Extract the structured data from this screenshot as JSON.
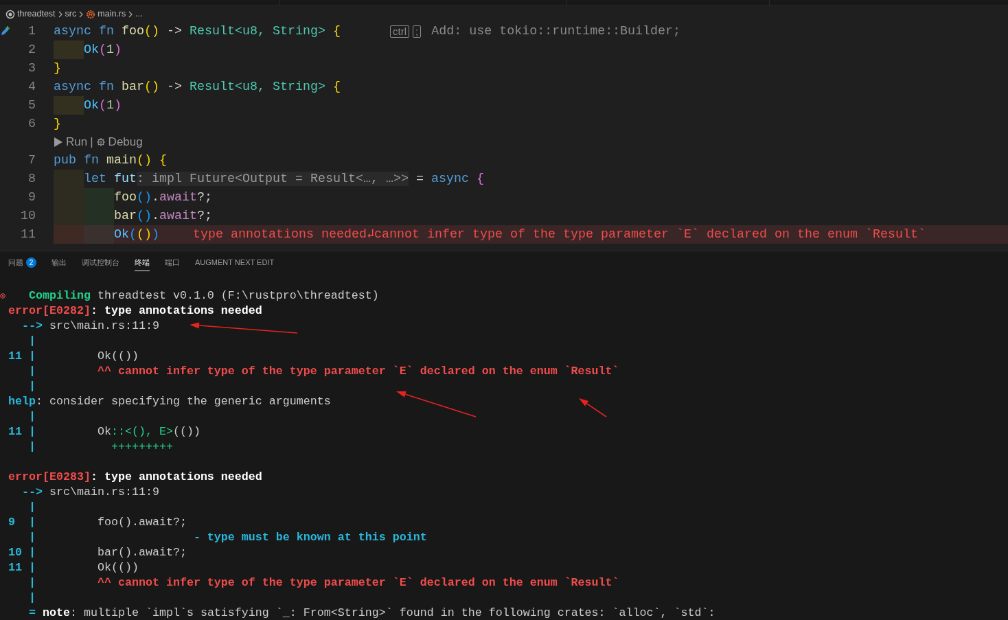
{
  "breadcrumbs": [
    {
      "kind": "root",
      "label": "threadtest"
    },
    {
      "kind": "folder",
      "label": "src"
    },
    {
      "kind": "rust",
      "label": "main.rs"
    },
    {
      "kind": "more",
      "label": "..."
    }
  ],
  "editor": {
    "lines": [
      {
        "kind": "code",
        "number": "1",
        "gutter_mark": {
          "kind": "edit"
        },
        "error": false,
        "tokens": [
          {
            "text": "async ",
            "kind": "kw"
          },
          {
            "text": "fn ",
            "kind": "kw"
          },
          {
            "text": "foo",
            "kind": "fn"
          },
          {
            "text": "()",
            "kind": "b1"
          },
          {
            "text": " -> ",
            "kind": "p"
          },
          {
            "text": "Result<u8, String> ",
            "kind": "ty"
          },
          {
            "text": "{",
            "kind": "b1"
          }
        ],
        "keys": [
          "ctrl",
          ";"
        ],
        "suggestion": "Add: use tokio::runtime::Builder;"
      },
      {
        "kind": "code",
        "number": "2",
        "error": false,
        "guides": [
          {
            "color": "#33301f"
          }
        ],
        "tokens": [
          {
            "text": "Ok",
            "kind": "var"
          },
          {
            "text": "(",
            "kind": "b2"
          },
          {
            "text": "1",
            "kind": "num"
          },
          {
            "text": ")",
            "kind": "b2"
          }
        ]
      },
      {
        "kind": "code",
        "number": "3",
        "error": false,
        "tokens": [
          {
            "text": "}",
            "kind": "b1"
          }
        ]
      },
      {
        "kind": "code",
        "number": "4",
        "error": false,
        "tokens": [
          {
            "text": "async ",
            "kind": "kw"
          },
          {
            "text": "fn ",
            "kind": "kw"
          },
          {
            "text": "bar",
            "kind": "fn"
          },
          {
            "text": "()",
            "kind": "b1"
          },
          {
            "text": " -> ",
            "kind": "p"
          },
          {
            "text": "Result<u8, String> ",
            "kind": "ty"
          },
          {
            "text": "{",
            "kind": "b1"
          }
        ]
      },
      {
        "kind": "code",
        "number": "5",
        "error": false,
        "guides": [
          {
            "color": "#33301f"
          }
        ],
        "tokens": [
          {
            "text": "Ok",
            "kind": "var"
          },
          {
            "text": "(",
            "kind": "b2"
          },
          {
            "text": "1",
            "kind": "num"
          },
          {
            "text": ")",
            "kind": "b2"
          }
        ]
      },
      {
        "kind": "code",
        "number": "6",
        "error": false,
        "tokens": [
          {
            "text": "}",
            "kind": "b1"
          }
        ]
      },
      {
        "kind": "codelens",
        "run": "Run",
        "separator": "|",
        "debug": "Debug"
      },
      {
        "kind": "code",
        "number": "7",
        "error": false,
        "tokens": [
          {
            "text": "pub ",
            "kind": "kw"
          },
          {
            "text": "fn ",
            "kind": "kw"
          },
          {
            "text": "main",
            "kind": "fn"
          },
          {
            "text": "() ",
            "kind": "b1"
          },
          {
            "text": "{",
            "kind": "b1"
          }
        ]
      },
      {
        "kind": "code",
        "number": "8",
        "error": false,
        "guides": [
          {
            "color": "#2e2c20"
          }
        ],
        "tokens": [
          {
            "text": "let ",
            "kind": "kw"
          },
          {
            "text": "fut",
            "kind": "id"
          },
          {
            "text": ": impl Future<Output = Result<…, …>>",
            "kind": "hint"
          },
          {
            "text": " = ",
            "kind": "p"
          },
          {
            "text": "async ",
            "kind": "kw"
          },
          {
            "text": "{",
            "kind": "b2"
          }
        ]
      },
      {
        "kind": "code",
        "number": "9",
        "error": false,
        "guides": [
          {
            "color": "#2e2c20"
          },
          {
            "color": "#243024"
          }
        ],
        "tokens": [
          {
            "text": "foo",
            "kind": "fn"
          },
          {
            "text": "()",
            "kind": "b3"
          },
          {
            "text": ".",
            "kind": "p"
          },
          {
            "text": "await",
            "kind": "ctl"
          },
          {
            "text": "?;",
            "kind": "p"
          }
        ]
      },
      {
        "kind": "code",
        "number": "10",
        "error": false,
        "guides": [
          {
            "color": "#2e2c20"
          },
          {
            "color": "#243024"
          }
        ],
        "tokens": [
          {
            "text": "bar",
            "kind": "fn"
          },
          {
            "text": "()",
            "kind": "b3"
          },
          {
            "text": ".",
            "kind": "p"
          },
          {
            "text": "await",
            "kind": "ctl"
          },
          {
            "text": "?;",
            "kind": "p"
          }
        ]
      },
      {
        "kind": "code",
        "number": "11",
        "error": true,
        "guides": [
          {
            "color": "#3e2a22"
          },
          {
            "color": "#3a302e"
          }
        ],
        "tokens": [
          {
            "text": "Ok",
            "kind": "var"
          },
          {
            "text": "(",
            "kind": "b3"
          },
          {
            "text": "()",
            "kind": "b1"
          },
          {
            "text": ")",
            "kind": "b3"
          }
        ],
        "diagnostic": "type annotations needed↲cannot infer type of the type parameter `E` declared on the enum `Result`"
      }
    ]
  },
  "panel": {
    "tabs": [
      {
        "label": "问题",
        "badge": "2",
        "selected": false
      },
      {
        "label": "输出",
        "selected": false
      },
      {
        "label": "调试控制台",
        "selected": false
      },
      {
        "label": "终端",
        "selected": true
      },
      {
        "label": "端口",
        "selected": false
      },
      {
        "label": "AUGMENT NEXT EDIT",
        "selected": false
      }
    ],
    "terminal": [
      {
        "kind": "text",
        "mark": {
          "kind": "error"
        },
        "segs": [
          {
            "text": "   Compiling",
            "kind": "ok"
          },
          {
            "text": " threadtest v0.1.0 (F:\\rustpro\\threadtest)",
            "kind": "p"
          }
        ]
      },
      {
        "kind": "text",
        "segs": [
          {
            "text": "error[E0282]",
            "kind": "err"
          },
          {
            "text": ": type annotations needed",
            "kind": "b"
          }
        ]
      },
      {
        "kind": "text",
        "segs": [
          {
            "text": "  -->",
            "kind": "gut"
          },
          {
            "text": " src\\main.rs:11:9",
            "kind": "p"
          }
        ]
      },
      {
        "kind": "text",
        "segs": [
          {
            "text": "   |",
            "kind": "gut"
          }
        ]
      },
      {
        "kind": "text",
        "segs": [
          {
            "text": "11 |",
            "kind": "gut"
          },
          {
            "text": "         Ok(())",
            "kind": "p"
          }
        ]
      },
      {
        "kind": "text",
        "segs": [
          {
            "text": "   |",
            "kind": "gut"
          },
          {
            "text": "         ^^ cannot infer type of the type parameter `E` declared on the enum `Result`",
            "kind": "err"
          }
        ]
      },
      {
        "kind": "text",
        "segs": [
          {
            "text": "   |",
            "kind": "gut"
          }
        ]
      },
      {
        "kind": "text",
        "segs": [
          {
            "text": "help",
            "kind": "gut"
          },
          {
            "text": ": consider specifying the generic arguments",
            "kind": "p"
          }
        ]
      },
      {
        "kind": "text",
        "segs": [
          {
            "text": "   |",
            "kind": "gut"
          }
        ]
      },
      {
        "kind": "text",
        "segs": [
          {
            "text": "11 |",
            "kind": "gut"
          },
          {
            "text": "         Ok",
            "kind": "p"
          },
          {
            "text": "::<(), E>",
            "kind": "add"
          },
          {
            "text": "(())",
            "kind": "p"
          }
        ]
      },
      {
        "kind": "text",
        "segs": [
          {
            "text": "   |",
            "kind": "gut"
          },
          {
            "text": "           +++++++++",
            "kind": "add"
          }
        ]
      },
      {
        "kind": "blank"
      },
      {
        "kind": "text",
        "segs": [
          {
            "text": "error[E0283]",
            "kind": "err"
          },
          {
            "text": ": type annotations needed",
            "kind": "b"
          }
        ]
      },
      {
        "kind": "text",
        "segs": [
          {
            "text": "  -->",
            "kind": "gut"
          },
          {
            "text": " src\\main.rs:11:9",
            "kind": "p"
          }
        ]
      },
      {
        "kind": "text",
        "segs": [
          {
            "text": "   |",
            "kind": "gut"
          }
        ]
      },
      {
        "kind": "text",
        "segs": [
          {
            "text": "9  |",
            "kind": "gut"
          },
          {
            "text": "         foo().await?;",
            "kind": "p"
          }
        ]
      },
      {
        "kind": "text",
        "segs": [
          {
            "text": "   |",
            "kind": "gut"
          },
          {
            "text": "                       - type must be known at this point",
            "kind": "gut"
          }
        ]
      },
      {
        "kind": "text",
        "segs": [
          {
            "text": "10 |",
            "kind": "gut"
          },
          {
            "text": "         bar().await?;",
            "kind": "p"
          }
        ]
      },
      {
        "kind": "text",
        "segs": [
          {
            "text": "11 |",
            "kind": "gut"
          },
          {
            "text": "         Ok(())",
            "kind": "p"
          }
        ]
      },
      {
        "kind": "text",
        "segs": [
          {
            "text": "   |",
            "kind": "gut"
          },
          {
            "text": "         ^^ cannot infer type of the type parameter `E` declared on the enum `Result`",
            "kind": "err"
          }
        ]
      },
      {
        "kind": "text",
        "segs": [
          {
            "text": "   |",
            "kind": "gut"
          }
        ]
      },
      {
        "kind": "text",
        "segs": [
          {
            "text": "   =",
            "kind": "gut"
          },
          {
            "text": " note",
            "kind": "b"
          },
          {
            "text": ": multiple `impl`s satisfying `_: From<String>` found in the following crates: `alloc`, `std`:",
            "kind": "p"
          }
        ]
      }
    ]
  },
  "annotations": [
    {
      "kind": "arrow"
    },
    {
      "kind": "arrow"
    },
    {
      "kind": "arrow"
    }
  ]
}
